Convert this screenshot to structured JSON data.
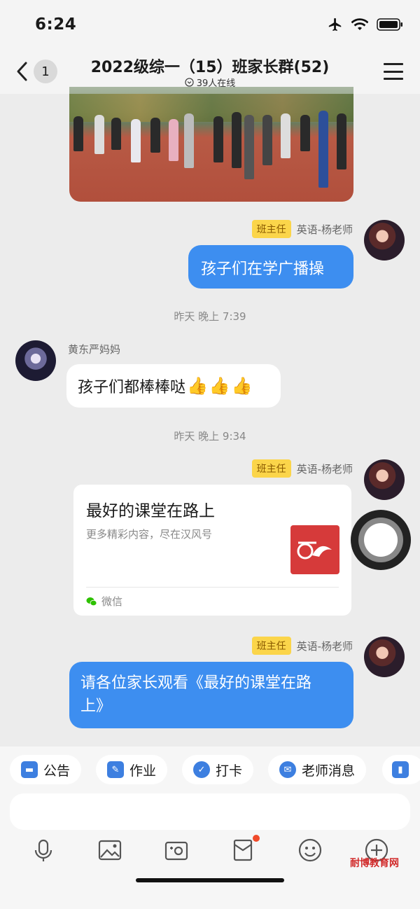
{
  "status": {
    "time": "6:24"
  },
  "nav": {
    "back_count": "1",
    "title": "2022级综一（15）班家长群(52)",
    "online": "39人在线"
  },
  "messages": {
    "m1": {
      "role": "班主任",
      "sender": "英语-杨老师",
      "text": "孩子们在学广播操"
    },
    "sep1": "昨天 晚上 7:39",
    "m2": {
      "sender": "黄东严妈妈",
      "text": "孩子们都棒棒哒"
    },
    "sep2": "昨天 晚上 9:34",
    "m3": {
      "role": "班主任",
      "sender": "英语-杨老师",
      "card": {
        "title": "最好的课堂在路上",
        "desc": "更多精彩内容，尽在汉风号",
        "source": "微信"
      }
    },
    "m4": {
      "role": "班主任",
      "sender": "英语-杨老师",
      "line1": "请各位家长观看《最好的课堂在路",
      "line2": "上》"
    }
  },
  "quick_actions": [
    "公告",
    "作业",
    "打卡",
    "老师消息"
  ],
  "watermark": "耐博教育网",
  "colors": {
    "bubble": "#3d8ef0",
    "role_badge": "#fbd54a",
    "background": "#ececec"
  },
  "icons": [
    "airplane-icon",
    "wifi-icon",
    "battery-icon",
    "back-chevron-icon",
    "menu-icon",
    "mic-icon",
    "image-icon",
    "camera-icon",
    "red-packet-icon",
    "emoji-icon",
    "plus-icon"
  ]
}
